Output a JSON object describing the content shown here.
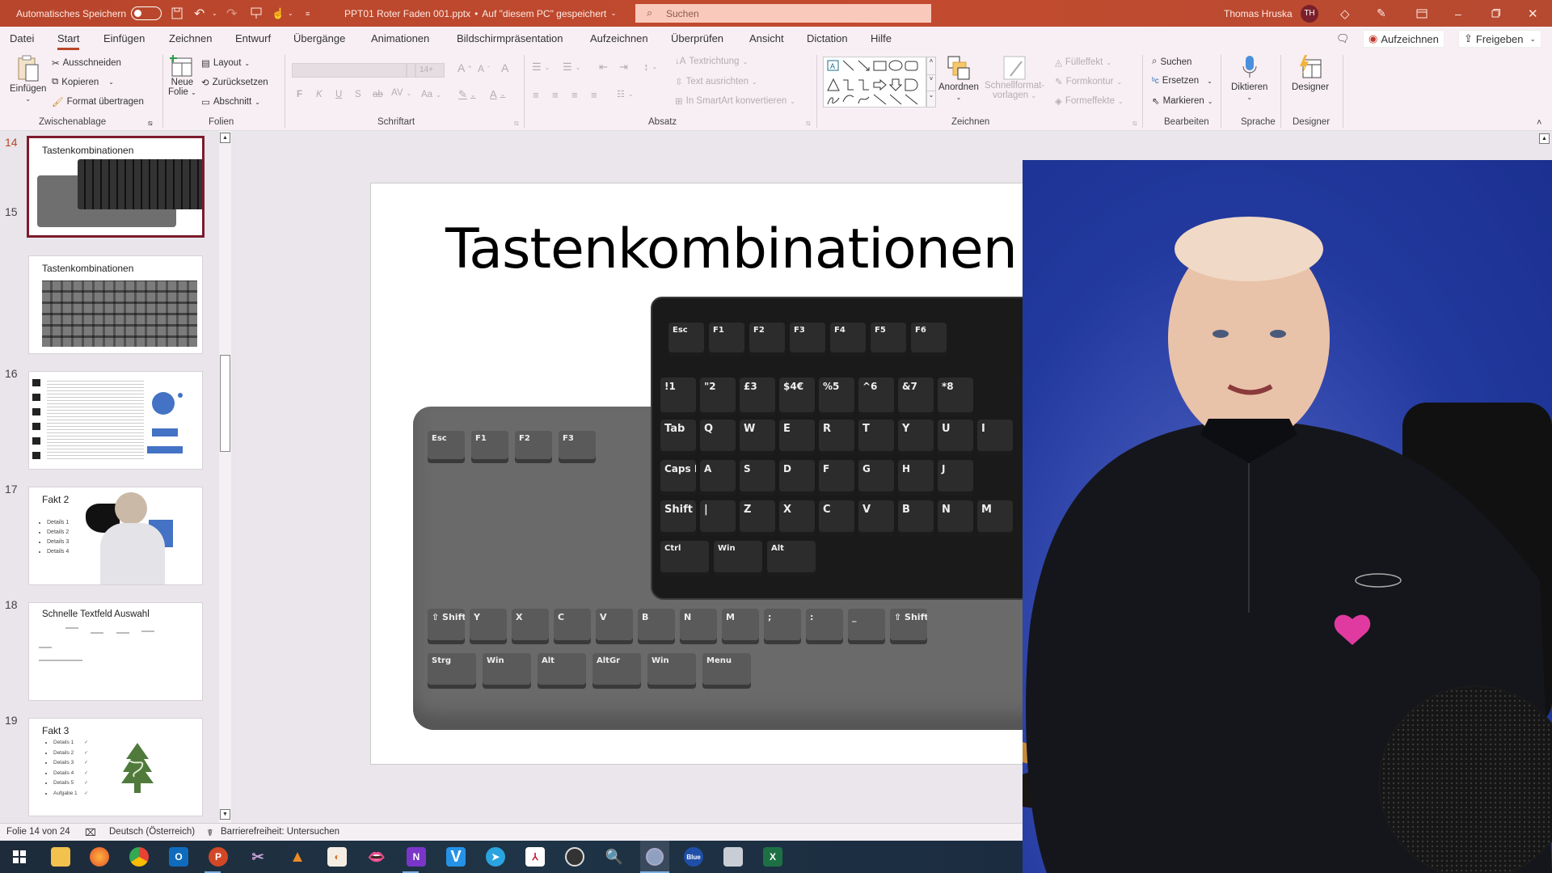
{
  "titlebar": {
    "autosave_label": "Automatisches Speichern",
    "autosave_state": "off",
    "document_title": "PPT01 Roter Faden 001.pptx",
    "save_status": "Auf \"diesem PC\" gespeichert",
    "search_placeholder": "Suchen",
    "user_name": "Thomas Hruska",
    "user_initials": "TH"
  },
  "menu": {
    "tabs": [
      "Datei",
      "Start",
      "Einfügen",
      "Zeichnen",
      "Entwurf",
      "Übergänge",
      "Animationen",
      "Bildschirmpräsentation",
      "Aufzeichnen",
      "Überprüfen",
      "Ansicht",
      "Dictation",
      "Hilfe"
    ],
    "active_tab": "Start",
    "record_button": "Aufzeichnen",
    "share_button": "Freigeben"
  },
  "ribbon": {
    "groups": {
      "clipboard": {
        "label": "Zwischenablage",
        "paste": "Einfügen",
        "cut": "Ausschneiden",
        "copy": "Kopieren",
        "format_painter": "Format übertragen"
      },
      "slides": {
        "label": "Folien",
        "new_slide_line1": "Neue",
        "new_slide_line2": "Folie",
        "layout": "Layout",
        "reset": "Zurücksetzen",
        "section": "Abschnitt"
      },
      "font": {
        "label": "Schriftart",
        "font_name": "",
        "font_size": "14+",
        "bold": "F",
        "italic": "K",
        "underline": "U",
        "shadow": "S",
        "strike": "ab",
        "spacing": "AV",
        "case": "Aa"
      },
      "paragraph": {
        "label": "Absatz",
        "text_direction": "Textrichtung",
        "align_text": "Text ausrichten",
        "smartart": "In SmartArt konvertieren"
      },
      "drawing": {
        "label": "Zeichnen",
        "arrange": "Anordnen",
        "quick_styles_line1": "Schnellformat-",
        "quick_styles_line2": "vorlagen",
        "fill": "Fülleffekt",
        "outline": "Formkontur",
        "effects": "Formeffekte"
      },
      "editing": {
        "label": "Bearbeiten",
        "find": "Suchen",
        "replace": "Ersetzen",
        "select": "Markieren"
      },
      "voice": {
        "label": "Sprache",
        "dictate": "Diktieren"
      },
      "designer": {
        "label": "Designer",
        "designer": "Designer"
      }
    }
  },
  "thumbnails": [
    {
      "number": "14",
      "title": "Tastenkombinationen",
      "selected": true
    },
    {
      "number": "15",
      "title": "Tastenkombinationen",
      "selected": false
    },
    {
      "number": "16",
      "title": "",
      "selected": false
    },
    {
      "number": "17",
      "title": "Fakt 2",
      "bullets": [
        "Details 1",
        "Details 2",
        "Details 3",
        "Details 4"
      ],
      "selected": false
    },
    {
      "number": "18",
      "title": "Schnelle Textfeld Auswahl",
      "selected": false
    },
    {
      "number": "19",
      "title": "Fakt 3",
      "bullets": [
        "Details 1",
        "Details 2",
        "Details 3",
        "Details 4",
        "Details 5",
        "Aufgabe 1"
      ],
      "selected": false
    }
  ],
  "slide": {
    "title": "Tastenkombinationen",
    "keyboard_front_row1": [
      "Esc",
      "F1",
      "F2",
      "F3",
      "F4",
      "F5",
      "F6"
    ],
    "keyboard_front_row2": [
      "!1",
      "\"2",
      "£3",
      "$4€",
      "%5",
      "^6",
      "&7",
      "*8"
    ],
    "keyboard_front_row3": [
      "Tab",
      "Q",
      "W",
      "E",
      "R",
      "T",
      "Y",
      "U",
      "I"
    ],
    "keyboard_front_row4": [
      "Caps Lock",
      "A",
      "S",
      "D",
      "F",
      "G",
      "H",
      "J"
    ],
    "keyboard_front_row5": [
      "Shift",
      "|",
      "Z",
      "X",
      "C",
      "V",
      "B",
      "N",
      "M"
    ],
    "keyboard_front_row6": [
      "Ctrl",
      "Win",
      "Alt"
    ],
    "keyboard_back_row1": [
      "Esc",
      "F1",
      "F2",
      "F3"
    ],
    "keyboard_back_row5": [
      "⇧ Shift",
      "Y",
      "X",
      "C",
      "V",
      "B",
      "N",
      "M",
      ";",
      ":",
      "_",
      "⇧ Shift"
    ],
    "keyboard_back_row6": [
      "Strg",
      "Win",
      "Alt",
      "AltGr",
      "Win",
      "Menu"
    ]
  },
  "statusbar": {
    "slide_counter": "Folie 14 von 24",
    "language": "Deutsch (Österreich)",
    "accessibility": "Barrierefreiheit: Untersuchen"
  },
  "taskbar": {
    "apps": [
      "start",
      "file-explorer",
      "firefox",
      "chrome",
      "outlook",
      "powerpoint",
      "snipping",
      "vlc",
      "app-orange",
      "app-lips",
      "onenote",
      "vectorworks",
      "telegram",
      "app-red",
      "obs",
      "magnifier",
      "app-circle",
      "blue-app",
      "screen-app",
      "excel"
    ]
  }
}
